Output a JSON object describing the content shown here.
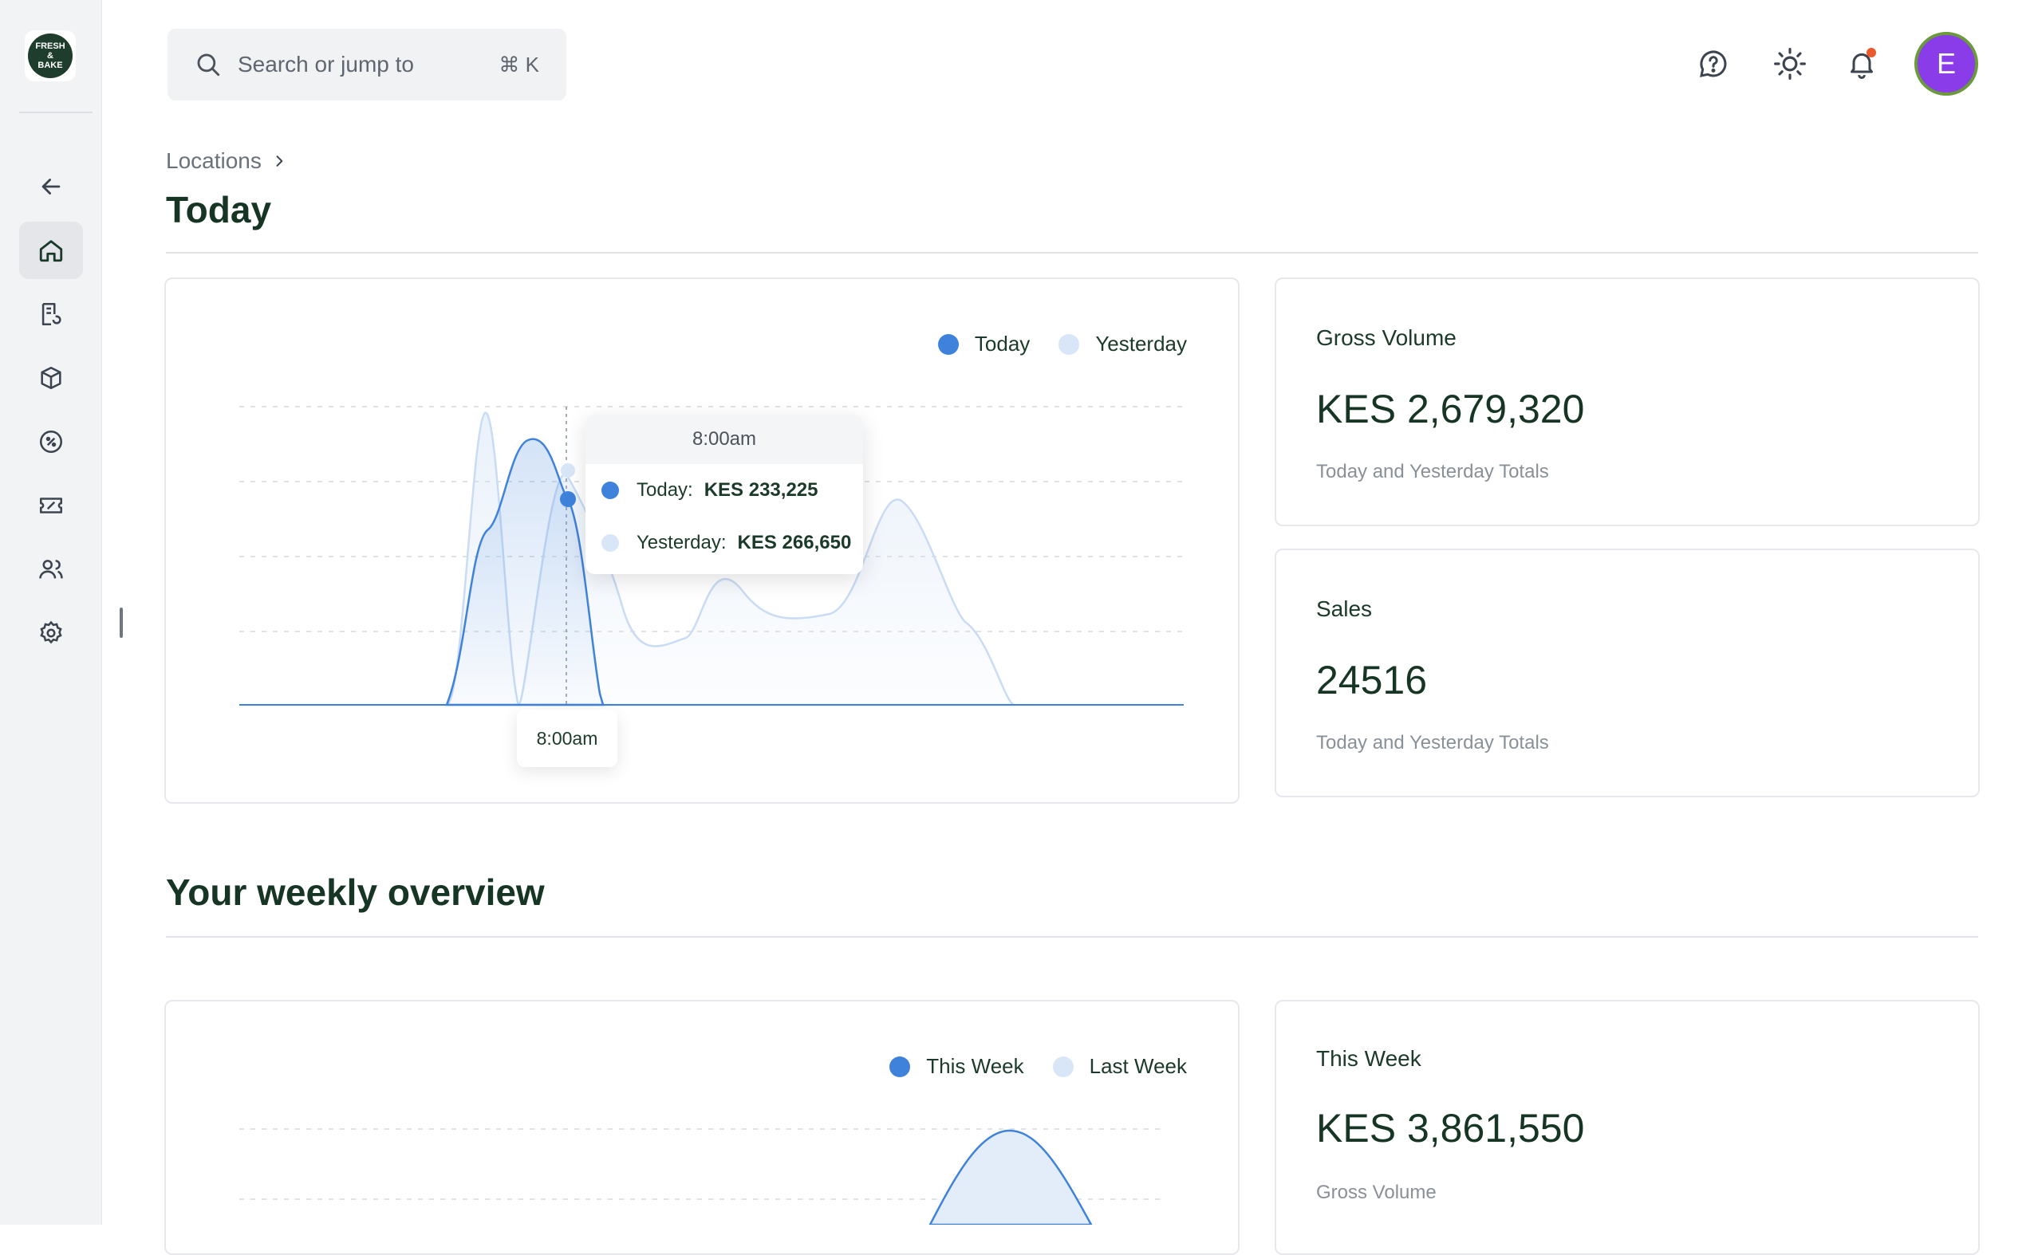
{
  "brand": {
    "logo_text": "FRESH & BAKE"
  },
  "header": {
    "search_placeholder": "Search or jump to",
    "search_shortcut": "⌘ K",
    "avatar_initial": "E",
    "icons": [
      "help-icon",
      "sun-icon",
      "bell-icon"
    ]
  },
  "sidebar": {
    "items": [
      {
        "icon": "arrow-left-icon"
      },
      {
        "icon": "home-icon",
        "active": true
      },
      {
        "icon": "receipt-icon"
      },
      {
        "icon": "box-icon"
      },
      {
        "icon": "discount-icon"
      },
      {
        "icon": "ticket-icon"
      },
      {
        "icon": "users-icon"
      },
      {
        "icon": "settings-icon"
      }
    ]
  },
  "breadcrumb": {
    "label": "Locations"
  },
  "today": {
    "title": "Today",
    "legend": {
      "today": "Today",
      "yesterday": "Yesterday"
    },
    "tooltip": {
      "time": "8:00am",
      "today_label": "Today:",
      "today_value": "KES 233,225",
      "yesterday_label": "Yesterday:",
      "yesterday_value": "KES 266,650"
    },
    "x_tip": "8:00am",
    "gross_volume": {
      "label": "Gross Volume",
      "value": "KES 2,679,320",
      "sub": "Today and Yesterday Totals"
    },
    "sales": {
      "label": "Sales",
      "value": "24516",
      "sub": "Today and Yesterday Totals"
    }
  },
  "weekly": {
    "title": "Your weekly overview",
    "legend": {
      "this_week": "This Week",
      "last_week": "Last Week"
    },
    "this_week": {
      "label": "This Week",
      "value": "KES 3,861,550",
      "sub": "Gross Volume"
    }
  },
  "colors": {
    "today": "#3f82dc",
    "yesterday": "#d8e6f7",
    "accent_green": "#173524"
  }
}
